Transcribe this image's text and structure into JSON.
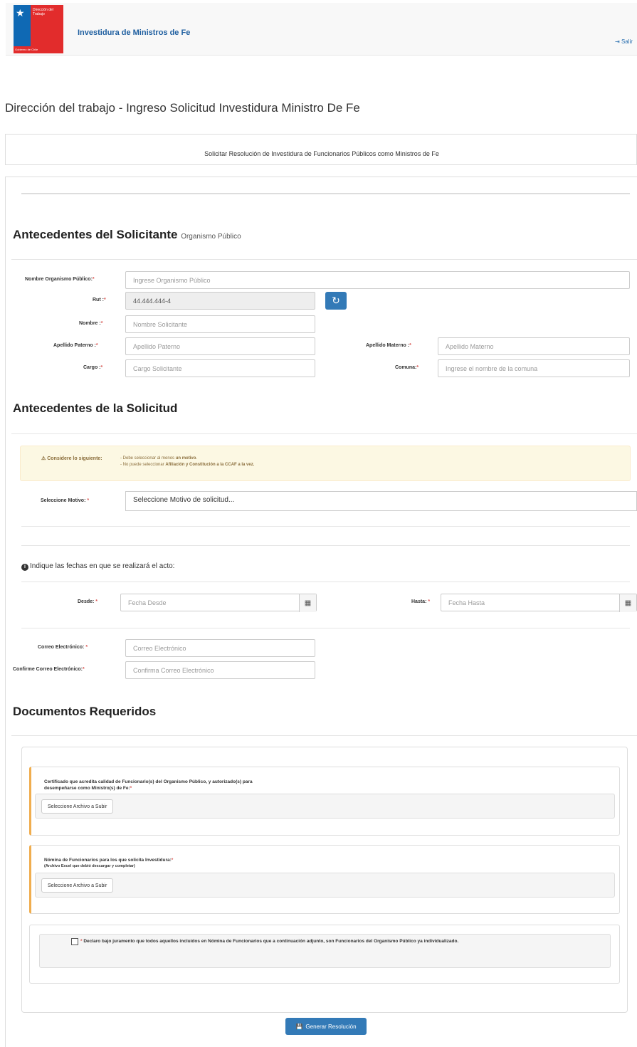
{
  "header": {
    "logo_text": "Dirección del Trabajo",
    "logo_footer": "Gobierno de Chile",
    "app_title": "Investidura de Ministros de Fe",
    "logout_icon": "sign-out-icon",
    "logout_label": "Salir"
  },
  "page_title": "Dirección del trabajo - Ingreso Solicitud Investidura Ministro De Fe",
  "banner": "Solicitar Resolución de Investidura de Funcionarios Públicos como Ministros de Fe",
  "solicitante": {
    "title": "Antecedentes del Solicitante",
    "subtitle": "Organismo Público",
    "organismo_label": "Nombre Organismo Público:",
    "organismo_placeholder": "Ingrese Organismo Público",
    "rut_label": "Rut :",
    "rut_value": "44.444.444-4",
    "nombre_label": "Nombre :",
    "nombre_placeholder": "Nombre Solicitante",
    "paterno_label": "Apellido Paterno :",
    "paterno_placeholder": "Apellido Paterno",
    "materno_label": "Apellido Materno :",
    "materno_placeholder": "Apellido Materno",
    "cargo_label": "Cargo :",
    "cargo_placeholder": "Cargo Solicitante",
    "comuna_label": "Comuna:",
    "comuna_placeholder": "Ingrese el nombre de la comuna",
    "required_mark": "*"
  },
  "solicitud": {
    "title": "Antecedentes de la Solicitud",
    "warning_label": "Considere lo siguiente:",
    "warning_line1_pre": "- Debe seleccionar al menos ",
    "warning_line1_bold": "un motivo",
    "warning_line2_pre": "- No puede seleccionar ",
    "warning_line2_bold": "Afiliación y Constitución a la CCAF a la vez.",
    "motivo_label": "Seleccione Motivo:",
    "motivo_value": "Seleccione Motivo de solicitud...",
    "fechas_note": "Indique las fechas en que se realizará el acto:",
    "desde_label": "Desde:",
    "desde_placeholder": "Fecha Desde",
    "hasta_label": "Hasta:",
    "hasta_placeholder": "Fecha Hasta",
    "correo_label": "Correo Electrónico:",
    "correo_placeholder": "Correo Electrónico",
    "confirma_label": "Confirme Correo Electrónico:",
    "confirma_placeholder": "Confirma Correo Electrónico"
  },
  "documentos": {
    "title": "Documentos Requeridos",
    "doc1_title_line1": "Certificado que acredita calidad de Funcionario(s) del Organismo Público, y autorizado(s) para",
    "doc1_title_line2": "desempeñarse como Ministro(s) de Fe:",
    "doc2_title": "Nómina de Funcionarios para los que solicita Investidura:",
    "doc2_note": "(Archivo Excel que debió descargar y completar)",
    "file_button": "Seleccione Archivo a Subir",
    "declaration": "Declaro bajo juramento que todos aquellos incluidos en Nómina de Funcionarios que a continuación adjunto, son Funcionarios del Organismo Público ya individualizado."
  },
  "submit_label": "Generar Resolución"
}
